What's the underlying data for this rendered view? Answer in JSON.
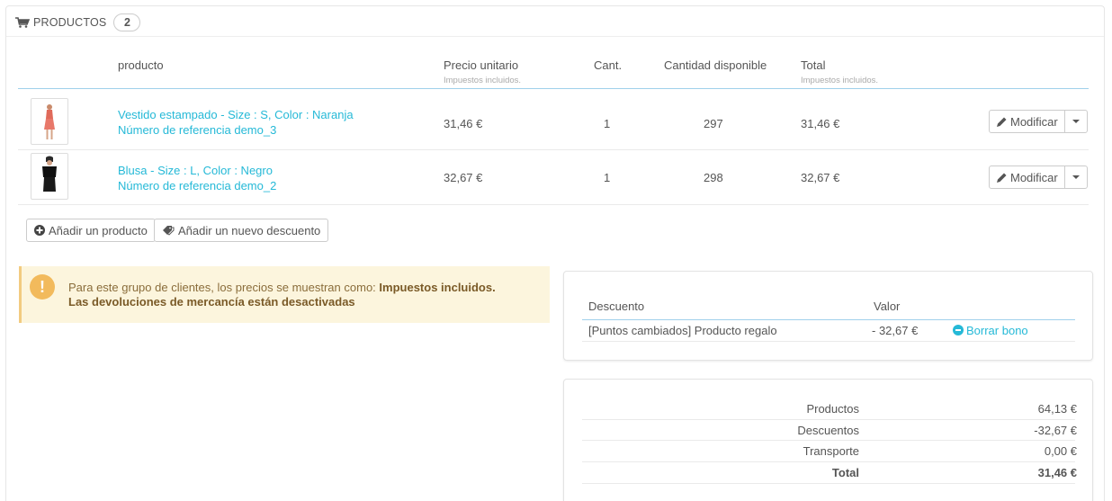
{
  "header": {
    "title": "PRODUCTOS",
    "count": "2",
    "icon": "shopping-cart-icon"
  },
  "table": {
    "columns": {
      "product": "producto",
      "unit_price": "Precio unitario",
      "unit_price_sub": "Impuestos incluidos.",
      "qty": "Cant.",
      "available": "Cantidad disponible",
      "total": "Total",
      "total_sub": "Impuestos incluidos."
    },
    "rows": [
      {
        "name": "Vestido estampado - Size : S, Color : Naranja",
        "reference": "Número de referencia demo_3",
        "unit_price": "31,46 €",
        "qty": "1",
        "available": "297",
        "total": "31,46 €",
        "action": "Modificar"
      },
      {
        "name": "Blusa - Size : L, Color : Negro",
        "reference": "Número de referencia demo_2",
        "unit_price": "32,67 €",
        "qty": "1",
        "available": "298",
        "total": "32,67 €",
        "action": "Modificar"
      }
    ]
  },
  "actions": {
    "add_product": "Añadir un producto",
    "add_discount": "Añadir un nuevo descuento"
  },
  "alert": {
    "text": "Para este grupo de clientes, los precios se muestran como: ",
    "bold1": "Impuestos incluidos.",
    "bold2": "Las devoluciones de mercancía están desactivadas"
  },
  "discounts": {
    "col_discount": "Descuento",
    "col_value": "Valor",
    "rows": [
      {
        "name": "[Puntos cambiados] Producto regalo",
        "value": "- 32,67 €",
        "action": "Borrar bono"
      }
    ]
  },
  "summary": {
    "rows": [
      {
        "label": "Productos",
        "value": "64,13 €"
      },
      {
        "label": "Descuentos",
        "value": "-32,67 €"
      },
      {
        "label": "Transporte",
        "value": "0,00 €"
      },
      {
        "label": "Total",
        "value": "31,46 €"
      }
    ]
  },
  "colors": {
    "link": "#25b9d7",
    "alert_bg": "#fcf5dd",
    "alert_icon": "#f2ba5c",
    "header_line": "#a0d0eb"
  }
}
